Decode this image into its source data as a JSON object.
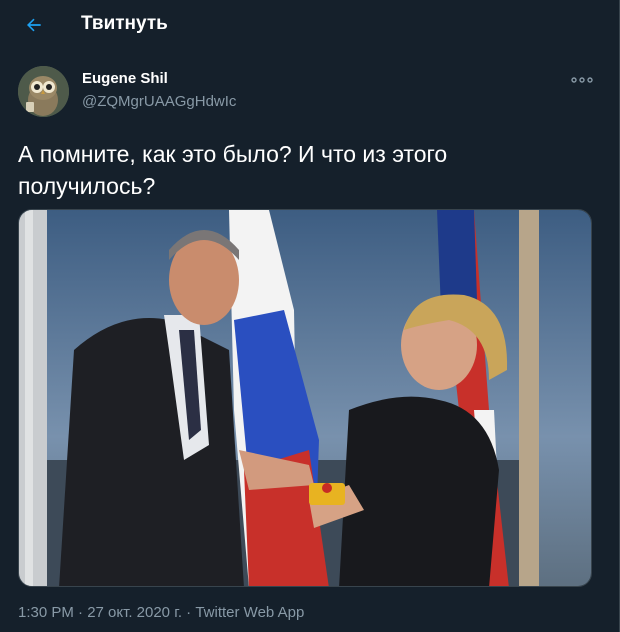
{
  "header": {
    "title": "Твитнуть"
  },
  "tweet": {
    "author": {
      "display_name": "Eugene Shil",
      "handle": "@ZQMgrUAAGgHdwIc"
    },
    "text": "А помните, как это было? И что из этого получилось?",
    "timestamp": "1:30 PM · 27 окт. 2020 г. · ",
    "source_app": "Twitter Web App"
  },
  "colors": {
    "background": "#15202b",
    "accent": "#1da1f2",
    "secondary_text": "#8899a6",
    "border": "#38444d"
  }
}
